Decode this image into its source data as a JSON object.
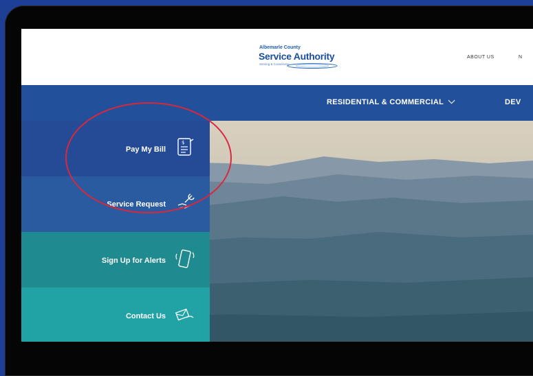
{
  "logo": {
    "line1": "Albemarle County",
    "line2": "Service Authority",
    "tagline": "Serving & Conserving"
  },
  "utility_nav": {
    "about": "ABOUT US",
    "partial": "N"
  },
  "main_nav": {
    "residential": "RESIDENTIAL & COMMERCIAL",
    "developers_partial": "DEV"
  },
  "quick_links": [
    {
      "label": "Pay My Bill",
      "icon": "bill-icon",
      "color": "#254b97"
    },
    {
      "label": "Service Request",
      "icon": "wrench-hand-icon",
      "color": "#2a5aa0"
    },
    {
      "label": "Sign Up for Alerts",
      "icon": "phone-alert-icon",
      "color": "#1f8a8f"
    },
    {
      "label": "Contact Us",
      "icon": "envelope-hand-icon",
      "color": "#21a3a6"
    }
  ],
  "colors": {
    "background": "#1d3f95",
    "nav": "#23509a",
    "annotation": "#d8283c"
  }
}
